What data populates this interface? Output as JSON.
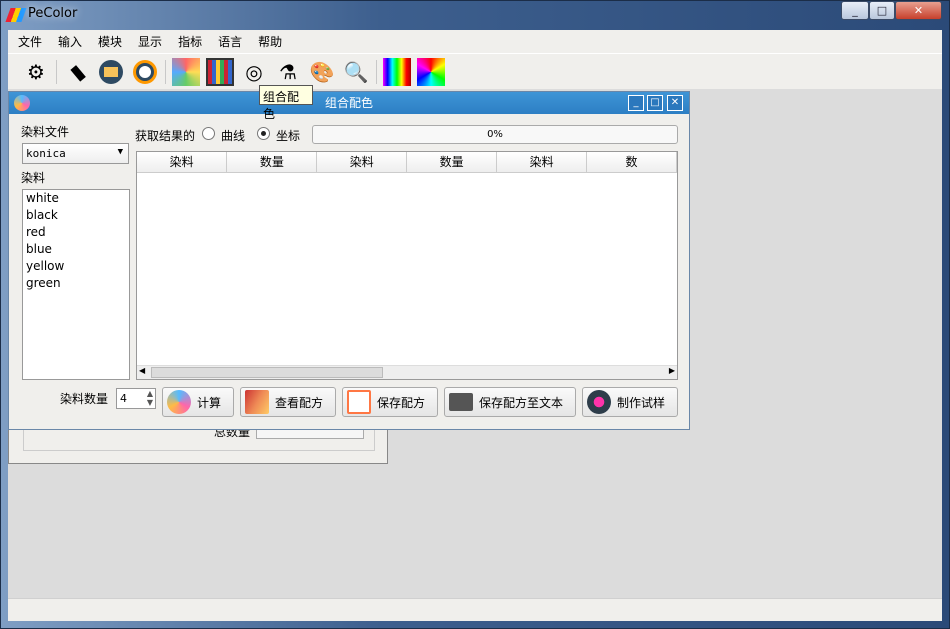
{
  "app": {
    "title": "PeColor",
    "window_controls": [
      "minimize",
      "maximize",
      "close"
    ]
  },
  "menu": [
    "文件",
    "输入",
    "模块",
    "显示",
    "指标",
    "语言",
    "帮助"
  ],
  "toolbar": {
    "icons": [
      "settings-gear-icon",
      "keyboard-icon",
      "folder-icon",
      "light-icon",
      "color-fan-icon",
      "color-grid-icon",
      "color-mix-icon",
      "lab-icon",
      "palette-icon",
      "magnifier-icon",
      "spectrum-icon",
      "color-coordinate-icon"
    ],
    "tooltip": "组合配色"
  },
  "background_window": {
    "label": "总数量"
  },
  "dialog": {
    "title": "组合配色",
    "dye_file_label": "染料文件",
    "dye_file_value": "konica",
    "dye_label": "染料",
    "dyes": [
      "white",
      "black",
      "red",
      "blue",
      "yellow",
      "green"
    ],
    "result_label": "获取结果的",
    "radio_options": [
      {
        "label": "曲线",
        "checked": false
      },
      {
        "label": "坐标",
        "checked": true
      }
    ],
    "progress": {
      "value": 0,
      "text": "0%"
    },
    "table_headers": [
      "染料",
      "数量",
      "染料",
      "数量",
      "染料",
      "数"
    ],
    "dye_count_label": "染料数量",
    "dye_count_value": "4",
    "buttons": [
      "计算",
      "查看配方",
      "保存配方",
      "保存配方至文本",
      "制作试样"
    ]
  }
}
